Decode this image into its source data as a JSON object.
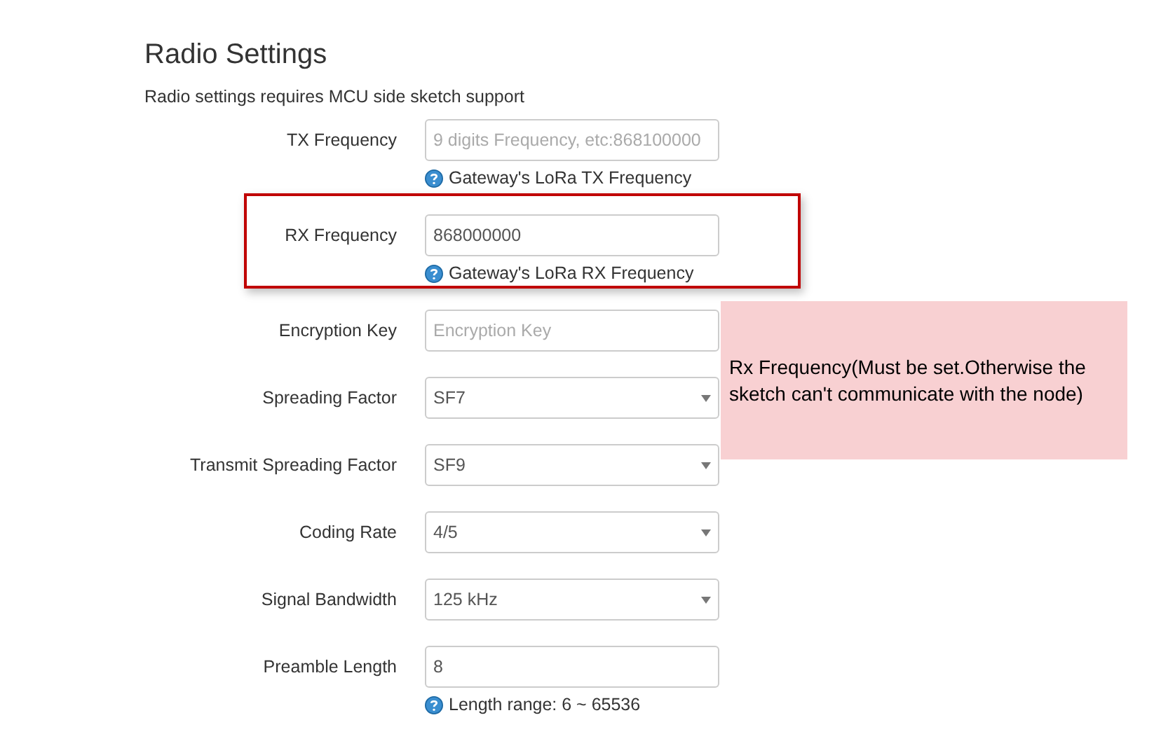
{
  "title": "Radio Settings",
  "description": "Radio settings requires MCU side sketch support",
  "fields": [
    {
      "label": "TX Frequency",
      "kind": "input",
      "placeholder": "9 digits Frequency, etc:868100000",
      "help": "Gateway's LoRa TX Frequency",
      "highlighted": false
    },
    {
      "label": "RX Frequency",
      "kind": "input",
      "value": "868000000",
      "help": "Gateway's LoRa RX Frequency",
      "highlighted": true
    },
    {
      "label": "Encryption Key",
      "kind": "input",
      "placeholder": "Encryption Key",
      "highlighted": false
    },
    {
      "label": "Spreading Factor",
      "kind": "select",
      "value": "SF7",
      "highlighted": false
    },
    {
      "label": "Transmit Spreading Factor",
      "kind": "select",
      "value": "SF9",
      "highlighted": false
    },
    {
      "label": "Coding Rate",
      "kind": "select",
      "value": "4/5",
      "highlighted": false
    },
    {
      "label": "Signal Bandwidth",
      "kind": "select",
      "value": "125 kHz",
      "highlighted": false
    },
    {
      "label": "Preamble Length",
      "kind": "input",
      "value": "8",
      "help": "Length range: 6 ~ 65536",
      "highlighted": false
    }
  ],
  "note": "Rx Frequency(Must be set.Otherwise the sketch can't communicate with the node)"
}
